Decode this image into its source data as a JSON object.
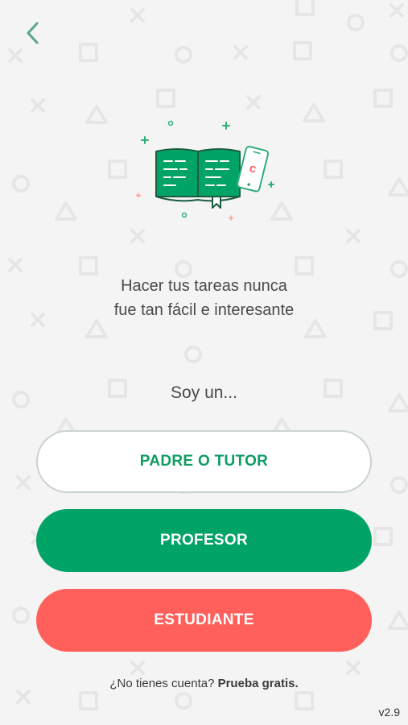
{
  "header": {
    "back_icon": "chevron-left-icon"
  },
  "illustration": {
    "icon": "book-and-phone-icon",
    "phone_letter": "c"
  },
  "main": {
    "tagline_line1": "Hacer tus tareas nunca",
    "tagline_line2": "fue tan fácil e interesante",
    "role_prompt": "Soy un..."
  },
  "roles": {
    "parent_label": "PADRE O TUTOR",
    "teacher_label": "PROFESOR",
    "student_label": "ESTUDIANTE"
  },
  "footer": {
    "signup_prompt": "¿No tienes cuenta?",
    "signup_link": "Prueba gratis.",
    "version": "v2.9"
  },
  "colors": {
    "background": "#f4f4f4",
    "brand_green": "#02a367",
    "student_red": "#ff605c",
    "text_dark": "#4a4a4a"
  }
}
